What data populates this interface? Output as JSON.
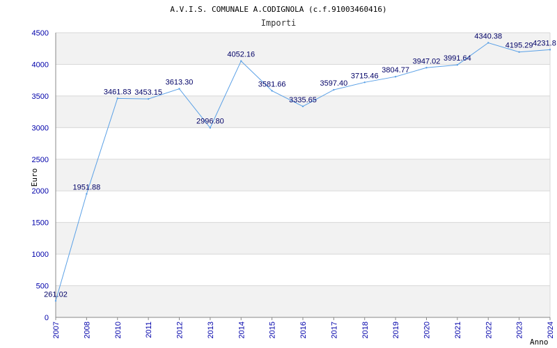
{
  "chart_data": {
    "type": "line",
    "title": "A.V.I.S. COMUNALE A.CODIGNOLA (c.f.91003460416)",
    "subtitle": "Importi",
    "xlabel": "Anno",
    "ylabel": "Euro",
    "ylim": [
      0,
      4500
    ],
    "yticks": [
      0,
      500,
      1000,
      1500,
      2000,
      2500,
      3000,
      3500,
      4000,
      4500
    ],
    "grid": true,
    "x": [
      "2007",
      "2008",
      "2010",
      "2011",
      "2012",
      "2013",
      "2014",
      "2015",
      "2016",
      "2017",
      "2018",
      "2019",
      "2020",
      "2021",
      "2022",
      "2023",
      "2024"
    ],
    "series": [
      {
        "values": [
          261.02,
          1951.88,
          3461.83,
          3453.15,
          3613.3,
          2996.8,
          4052.16,
          3581.66,
          3335.65,
          3597.4,
          3715.46,
          3804.77,
          3947.02,
          3991.64,
          4340.38,
          4195.29,
          4231.8
        ],
        "labels": [
          "261.02",
          "1951.88",
          "3461.83",
          "3453.15",
          "3613.30",
          "2996.80",
          "4052.16",
          "3581.66",
          "3335.65",
          "3597.40",
          "3715.46",
          "3804.77",
          "3947.02",
          "3991.64",
          "4340.38",
          "4195.29",
          "4231.8"
        ]
      }
    ],
    "colors": {
      "line": "#5aa0e6",
      "band": "#f2f2f2",
      "grid": "#d8d8d8",
      "tick_text": "#0000aa",
      "data_label": "#000066"
    }
  }
}
